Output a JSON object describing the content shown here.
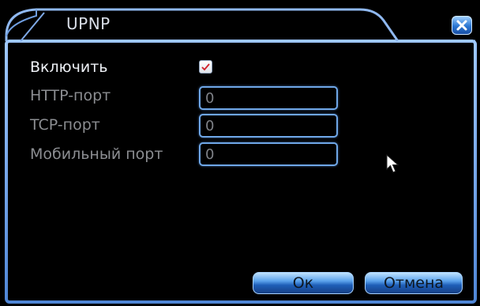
{
  "dialog": {
    "title": "UPNP",
    "close_icon": "close-x-icon",
    "accent_color": "#5aa2ec"
  },
  "form": {
    "enable": {
      "label": "Включить",
      "checked": true
    },
    "fields": [
      {
        "label": "HTTP-порт",
        "value": "0"
      },
      {
        "label": "TCP-порт",
        "value": "0"
      },
      {
        "label": "Мобильный порт",
        "value": "0"
      }
    ]
  },
  "buttons": {
    "ok_label": "Ок",
    "cancel_label": "Отмена"
  }
}
